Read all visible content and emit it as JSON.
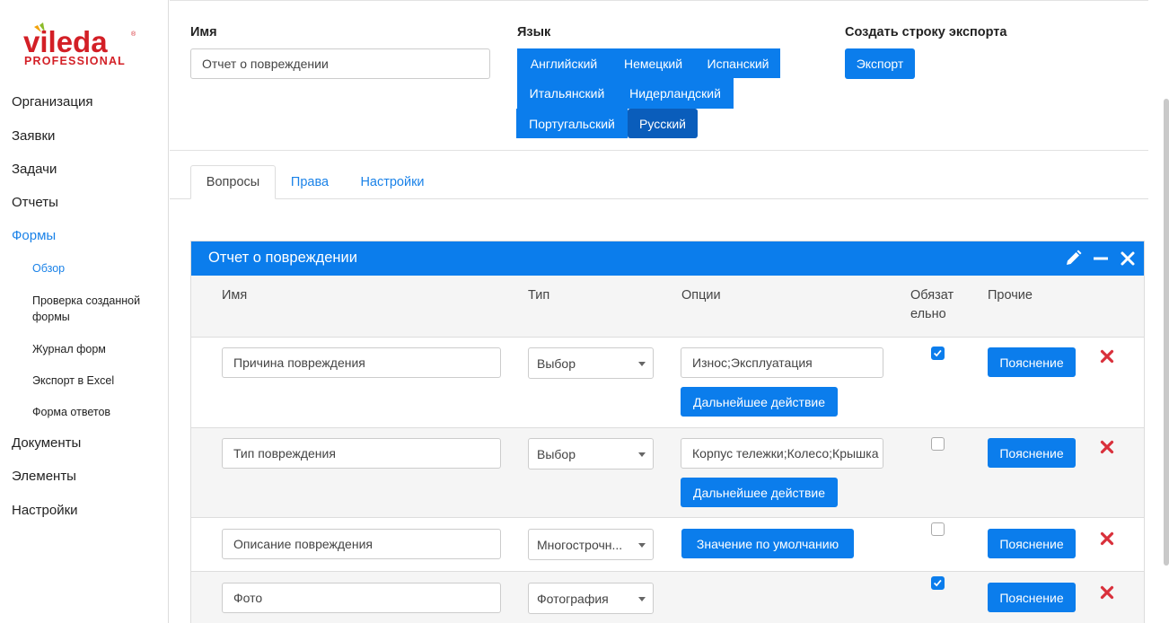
{
  "brand": {
    "name": "vileda",
    "sub": "PROFESSIONAL",
    "color": "#d31f26"
  },
  "sidebar": {
    "items": [
      {
        "label": "Организация"
      },
      {
        "label": "Заявки"
      },
      {
        "label": "Задачи"
      },
      {
        "label": "Отчеты"
      },
      {
        "label": "Формы"
      },
      {
        "label": "Документы"
      },
      {
        "label": "Элементы"
      },
      {
        "label": "Настройки"
      }
    ],
    "sub_items": [
      {
        "label": "Обзор"
      },
      {
        "label": "Проверка созданной формы"
      },
      {
        "label": "Журнал форм"
      },
      {
        "label": "Экспорт в Excel"
      },
      {
        "label": "Форма ответов"
      }
    ]
  },
  "form": {
    "name_label": "Имя",
    "name_value": "Отчет о повреждении",
    "language_label": "Язык",
    "languages": [
      "Английский",
      "Немецкий",
      "Испанский",
      "Итальянский",
      "Нидерландский",
      "Португальский",
      "Русский"
    ],
    "selected_language": "Русский",
    "export_label": "Создать строку экспорта",
    "export_button": "Экспорт"
  },
  "tabs": [
    "Вопросы",
    "Права",
    "Настройки"
  ],
  "panel": {
    "title": "Отчет о повреждении",
    "columns": {
      "name": "Имя",
      "type": "Тип",
      "options": "Опции",
      "required": "Обязат ельно",
      "other": "Прочие"
    },
    "rows": [
      {
        "name": "Причина повреждения",
        "type": "Выбор",
        "options_value": "Износ;Эксплуатация",
        "action": "Дальнейшее действие",
        "required": true,
        "explain": "Пояснение"
      },
      {
        "name": "Тип повреждения",
        "type": "Выбор",
        "options_value": "Корпус тележки;Колесо;Крышка",
        "action": "Дальнейшее действие",
        "required": false,
        "explain": "Пояснение"
      },
      {
        "name": "Описание повреждения",
        "type": "Многострочн...",
        "default_button": "Значение по умолчанию",
        "required": false,
        "explain": "Пояснение"
      },
      {
        "name": "Фото",
        "type": "Фотография",
        "required": true,
        "explain": "Пояснение"
      }
    ]
  },
  "colors": {
    "primary": "#0b7dec",
    "primary_dark": "#0a5dbb",
    "link": "#1a82e8",
    "danger": "#d9303b"
  }
}
